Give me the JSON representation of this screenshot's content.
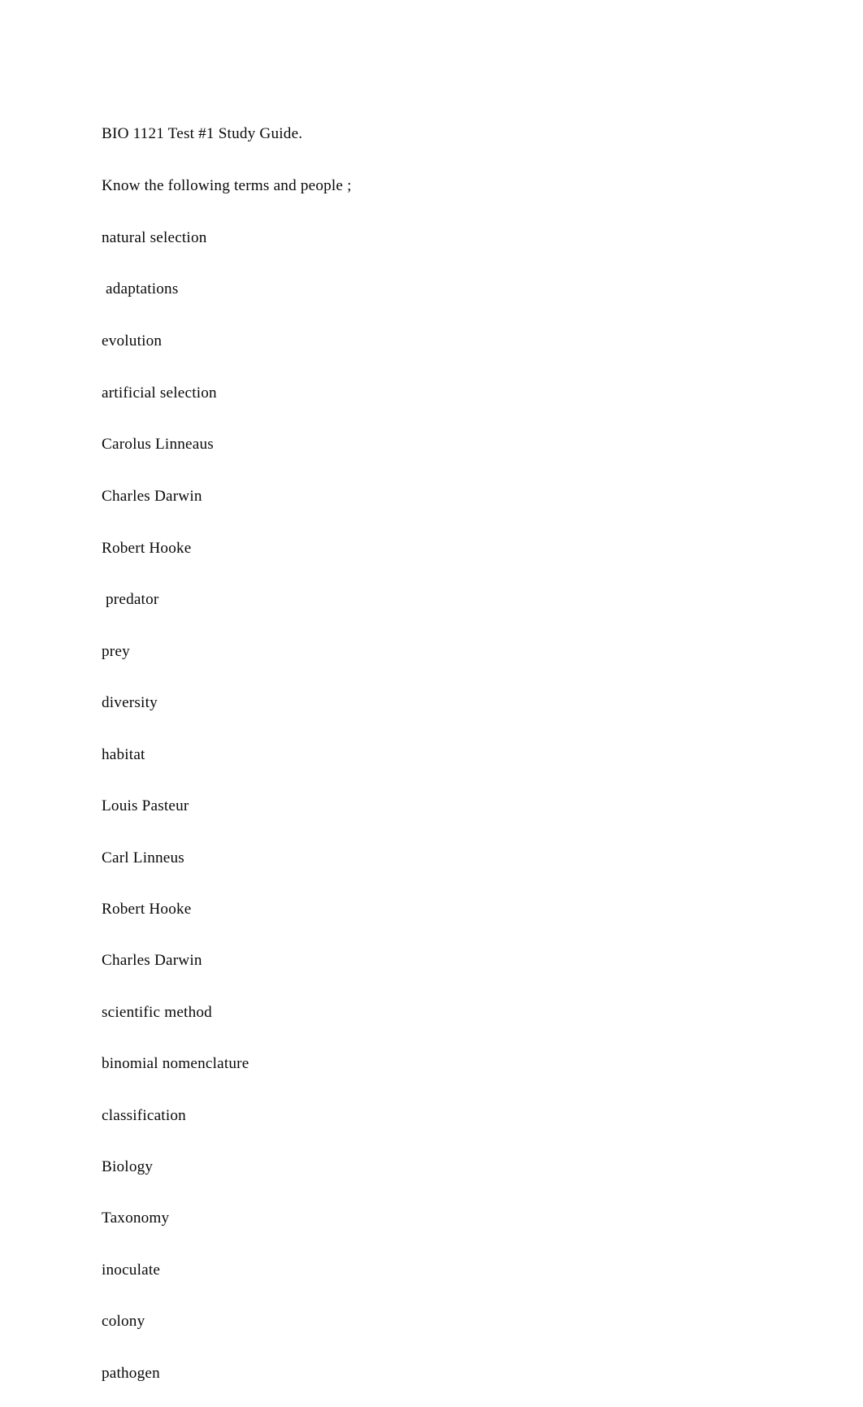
{
  "document": {
    "title": "BIO 1121 Test #1 Study Guide.",
    "instruction": "Know the following terms and people ;",
    "lines": [
      {
        "text": "BIO 1121 Test #1 Study Guide."
      },
      {
        "text": "Know the following terms and people ;"
      },
      {
        "text": "natural selection"
      },
      {
        "text": " adaptations"
      },
      {
        "text": "evolution"
      },
      {
        "text": "artificial selection"
      },
      {
        "text": "Carolus Linneaus"
      },
      {
        "text": "Charles Darwin"
      },
      {
        "text": "Robert Hooke"
      },
      {
        "text": " predator"
      },
      {
        "text": "prey"
      },
      {
        "text": "diversity"
      },
      {
        "text": "habitat"
      },
      {
        "text": "Louis Pasteur"
      },
      {
        "text": "Carl Linneus"
      },
      {
        "text": "Robert Hooke"
      },
      {
        "text": "Charles Darwin"
      },
      {
        "text": "scientific method"
      },
      {
        "text": "binomial nomenclature"
      },
      {
        "text": "classification"
      },
      {
        "text": "Biology"
      },
      {
        "text": "Taxonomy"
      },
      {
        "text": "inoculate"
      },
      {
        "text": "colony"
      },
      {
        "text": "pathogen"
      }
    ],
    "terms_and_people": [
      "natural selection",
      "adaptations",
      "evolution",
      "artificial selection",
      "Carolus Linneaus",
      "Charles Darwin",
      "Robert Hooke",
      "predator",
      "prey",
      "diversity",
      "habitat",
      "Louis Pasteur",
      "Carl Linneus",
      "Robert Hooke",
      "Charles Darwin",
      "scientific method",
      "binomial nomenclature",
      "classification",
      "Biology",
      "Taxonomy",
      "inoculate",
      "colony",
      "pathogen"
    ],
    "colors": {
      "page_background": "#ffffff",
      "text": "#0a0a0a"
    }
  }
}
